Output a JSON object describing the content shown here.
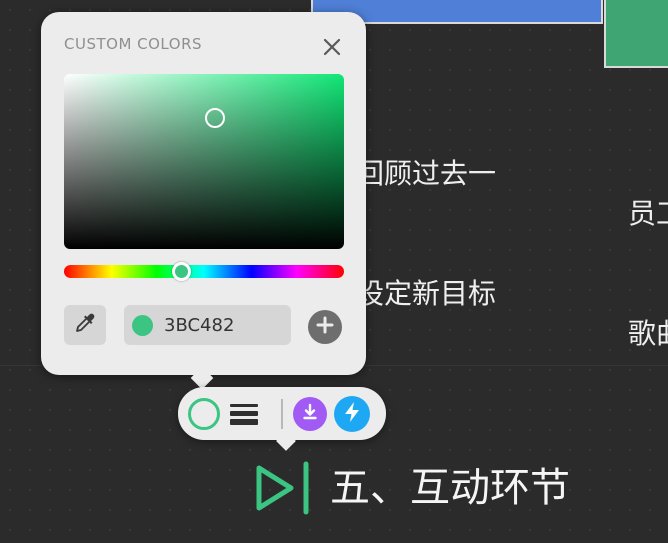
{
  "canvas": {
    "text_block_1": "领导回顾过去一年并设定新目标",
    "text_block_1_lines": [
      "领导回顾过去一",
      "年并设定新目标"
    ],
    "text_block_2_lines": [
      "员工",
      "歌曲"
    ],
    "section_heading": "五、互动环节",
    "shape_colors": {
      "blue": "#4F7FD6",
      "green": "#3FA673"
    }
  },
  "color_picker": {
    "title": "CUSTOM COLORS",
    "close_icon": "close-icon",
    "eyedropper_icon": "eyedropper-icon",
    "hex_value": "3BC482",
    "selected_color": "#3BC482",
    "add_icon": "plus-circle-icon"
  },
  "toolbar": {
    "color_ring": "#3BC482",
    "line_style_icon": "line-weight-icon",
    "download_icon": "download-icon",
    "download_color": "#A15BF4",
    "lightning_icon": "lightning-icon",
    "lightning_color": "#1EA8F4"
  }
}
